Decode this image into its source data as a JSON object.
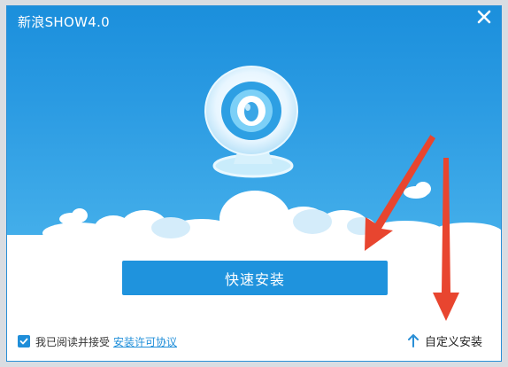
{
  "window": {
    "title": "新浪SHOW4.0"
  },
  "actions": {
    "quick_install": "快速安装",
    "agree_text": "我已阅读并接受",
    "license_link": "安装许可协议",
    "custom_install": "自定义安装",
    "agreement_checked": true
  },
  "colors": {
    "banner_top": "#1b8fdc",
    "banner_bottom": "#43aeea",
    "button": "#1f93dd",
    "annotation_arrow": "#e8452f"
  },
  "icons": {
    "close": "close-icon",
    "logo": "webcam-logo-icon",
    "checkbox": "checkmark-icon",
    "custom": "arrow-up-icon",
    "annotation": "red-arrow-icon"
  }
}
